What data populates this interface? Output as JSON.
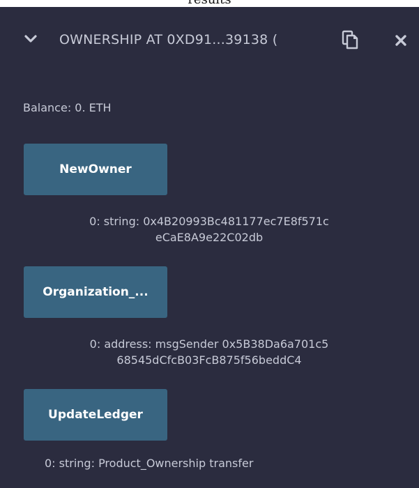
{
  "top_strip": {
    "text": "results"
  },
  "header": {
    "contract_title": "OWNERSHIP AT 0XD91...39138 (",
    "icons": [
      "chevron-down-icon",
      "copy-icon",
      "close-icon"
    ]
  },
  "balance": "Balance: 0. ETH",
  "functions": [
    {
      "label": "NewOwner",
      "output_line1": "0: string: 0x4B20993Bc481177ec7E8f571c",
      "output_line2": "eCaE8A9e22C02db"
    },
    {
      "label": "Organization_...",
      "output_line1": "0: address: msgSender 0x5B38Da6a701c5",
      "output_line2": "68545dCfcB03FcB875f56beddC4"
    },
    {
      "label": "UpdateLedger",
      "output_line1": "0: string: Product_Ownership transfer",
      "output_line2": ""
    }
  ],
  "colors": {
    "panel_bg": "#2b2c3f",
    "button_bg": "#396581",
    "text": "#c7cad7",
    "button_text": "#ffffff"
  }
}
